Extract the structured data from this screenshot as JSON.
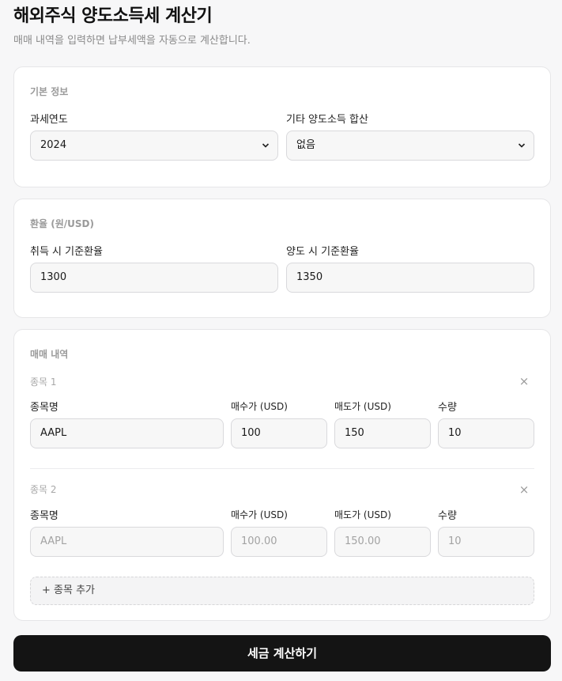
{
  "header": {
    "title": "해외주식 양도소득세 계산기",
    "subtitle": "매매 내역을 입력하면 납부세액을 자동으로 계산합니다."
  },
  "basic_info": {
    "section_title": "기본 정보",
    "tax_year": {
      "label": "과세연도",
      "value": "2024"
    },
    "other_gains": {
      "label": "기타 양도소득 합산",
      "value": "없음"
    }
  },
  "exchange_rate": {
    "section_title": "환율 (원/USD)",
    "acquisition": {
      "label": "취득 시 기준환율",
      "value": "1300"
    },
    "transfer": {
      "label": "양도 시 기준환율",
      "value": "1350"
    }
  },
  "trades": {
    "section_title": "매매 내역",
    "column_labels": {
      "name": "종목명",
      "buy_price": "매수가 (USD)",
      "sell_price": "매도가 (USD)",
      "quantity": "수량"
    },
    "items": [
      {
        "label": "종목 1",
        "name": "AAPL",
        "buy_price": "100",
        "sell_price": "150",
        "quantity": "10"
      },
      {
        "label": "종목 2",
        "name_placeholder": "AAPL",
        "buy_placeholder": "100.00",
        "sell_placeholder": "150.00",
        "quantity_placeholder": "10"
      }
    ],
    "remove_symbol": "×",
    "add_label": "+ 종목 추가"
  },
  "submit_label": "세금 계산하기"
}
